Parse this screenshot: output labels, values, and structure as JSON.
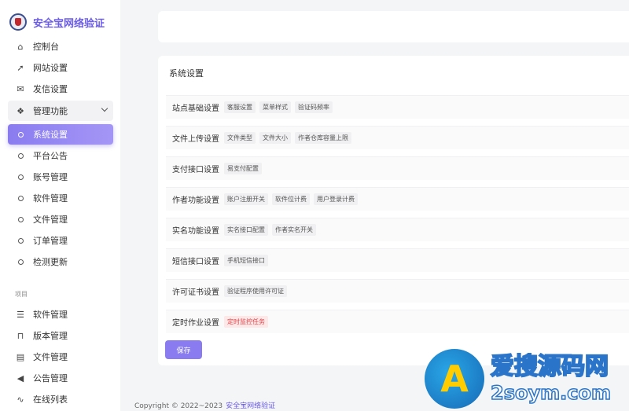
{
  "brand": {
    "name": "安全宝网络验证"
  },
  "sidebar": {
    "items": [
      {
        "label": "控制台",
        "icon": "home-icon"
      },
      {
        "label": "网站设置",
        "icon": "rocket-icon"
      },
      {
        "label": "发信设置",
        "icon": "mail-icon"
      },
      {
        "label": "管理功能",
        "icon": "apps-icon"
      }
    ],
    "sub_items": [
      {
        "label": "系统设置"
      },
      {
        "label": "平台公告"
      },
      {
        "label": "账号管理"
      },
      {
        "label": "软件管理"
      },
      {
        "label": "文件管理"
      },
      {
        "label": "订单管理"
      },
      {
        "label": "检测更新"
      }
    ],
    "section_label": "项目",
    "project_items": [
      {
        "label": "软件管理",
        "icon": "server-icon"
      },
      {
        "label": "版本管理",
        "icon": "bookmark-icon"
      },
      {
        "label": "文件管理",
        "icon": "file-icon"
      },
      {
        "label": "公告管理",
        "icon": "megaphone-icon"
      },
      {
        "label": "在线列表",
        "icon": "activity-icon"
      }
    ]
  },
  "main": {
    "title": "系统设置",
    "rows": [
      {
        "label": "站点基础设置",
        "tags": [
          "客服设置",
          "菜单样式",
          "验证码频率"
        ]
      },
      {
        "label": "文件上传设置",
        "tags": [
          "文件类型",
          "文件大小",
          "作者仓库容量上限"
        ]
      },
      {
        "label": "支付接口设置",
        "tags": [
          "易支付配置"
        ]
      },
      {
        "label": "作者功能设置",
        "tags": [
          "账户注册开关",
          "软件位计费",
          "用户登录计费"
        ]
      },
      {
        "label": "实名功能设置",
        "tags": [
          "实名接口配置",
          "作者实名开关"
        ]
      },
      {
        "label": "短信接口设置",
        "tags": [
          "手机短信接口"
        ]
      },
      {
        "label": "许可证书设置",
        "tags": [
          "验证程序使用许可证"
        ]
      },
      {
        "label": "定时作业设置",
        "tags": [
          "定时监控任务"
        ]
      }
    ],
    "save_label": "保存"
  },
  "footer": {
    "copyright": "Copyright © 2022~2023",
    "link": "安全宝网络验证"
  },
  "watermark": {
    "cn": "爱搜源码网",
    "en": "2soym.com"
  },
  "colors": {
    "accent": "#8a7cf0",
    "brand_text": "#6b5ce7",
    "danger_tag": "#e0474c"
  }
}
